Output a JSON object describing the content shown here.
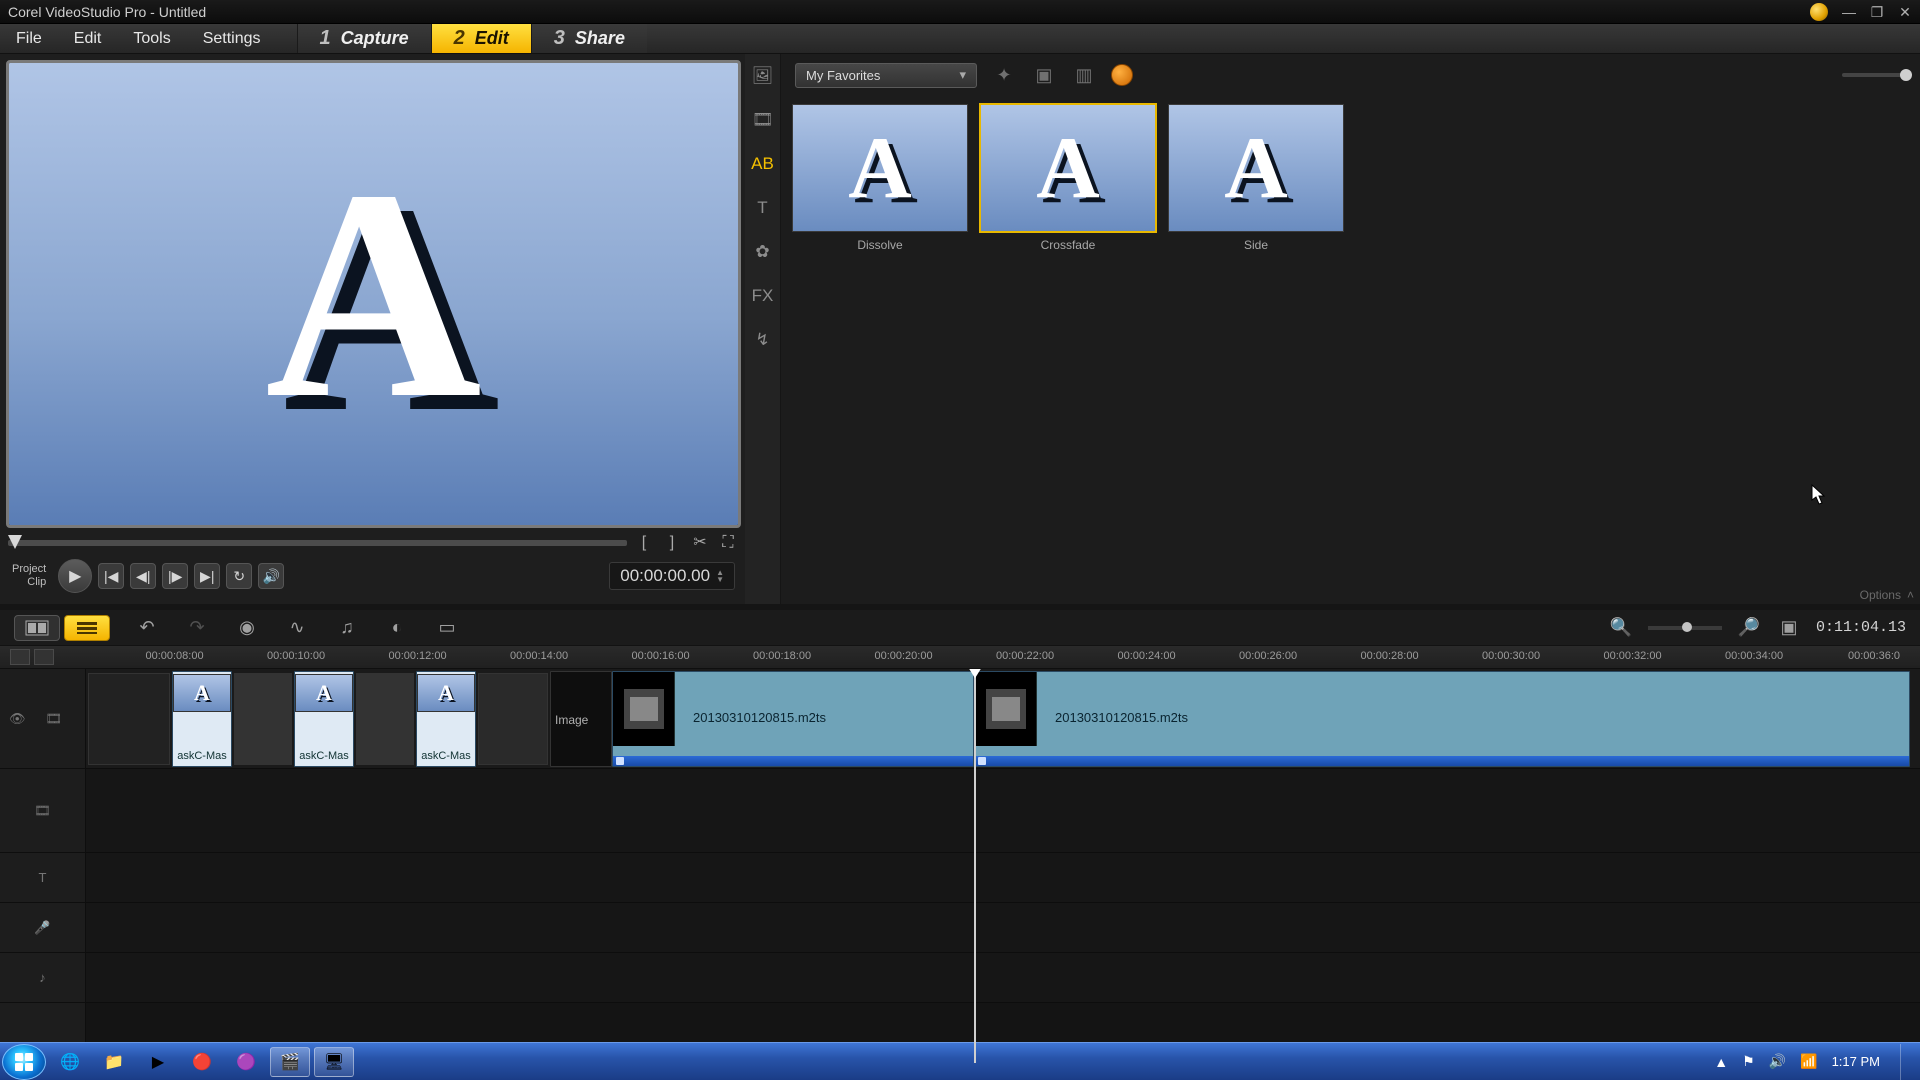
{
  "title_bar": {
    "title": "Corel VideoStudio Pro - Untitled"
  },
  "menu": [
    "File",
    "Edit",
    "Tools",
    "Settings"
  ],
  "steps": [
    {
      "num": "1",
      "label": "Capture"
    },
    {
      "num": "2",
      "label": "Edit"
    },
    {
      "num": "3",
      "label": "Share"
    }
  ],
  "preview": {
    "project_label": "Project",
    "clip_label": "Clip",
    "timecode": "00:00:00.00"
  },
  "library": {
    "dropdown": "My Favorites",
    "items": [
      {
        "label": "Dissolve"
      },
      {
        "label": "Crossfade"
      },
      {
        "label": "Side"
      }
    ],
    "options_label": "Options"
  },
  "timeline": {
    "project_duration": "0:11:04.13",
    "ruler": [
      "00:00:08:00",
      "00:00:10:00",
      "00:00:12:00",
      "00:00:14:00",
      "00:00:16:00",
      "00:00:18:00",
      "00:00:20:00",
      "00:00:22:00",
      "00:00:24:00",
      "00:00:26:00",
      "00:00:28:00",
      "00:00:30:00",
      "00:00:32:00",
      "00:00:34:00",
      "00:00:36:0"
    ],
    "clips": {
      "group_label": "askC-Mas",
      "image_label": "Image",
      "video_a": "20130310120815.m2ts",
      "video_b": "20130310120815.m2ts"
    }
  },
  "taskbar": {
    "clock": "1:17 PM"
  }
}
